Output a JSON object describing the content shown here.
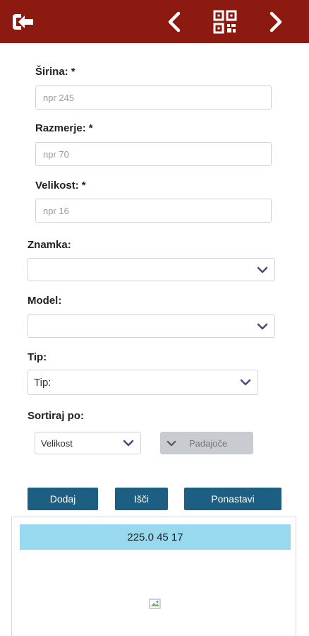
{
  "fields": {
    "sirina": {
      "label": "Širina:",
      "required": "*",
      "placeholder": "npr 245"
    },
    "razmerje": {
      "label": "Razmerje:",
      "required": "*",
      "placeholder": "npr 70"
    },
    "velikost": {
      "label": "Velikost:",
      "required": "*",
      "placeholder": "npr 16"
    },
    "znamka": {
      "label": "Znamka:",
      "value": ""
    },
    "model": {
      "label": "Model:",
      "value": ""
    },
    "tip": {
      "label": "Tip:",
      "value": "Tip:"
    },
    "sort": {
      "label": "Sortiraj po:",
      "value": "Velikost",
      "order": "Padajoče"
    }
  },
  "buttons": {
    "dodaj": "Dodaj",
    "isci": "Išči",
    "ponastavi": "Ponastavi"
  },
  "result": {
    "header": "225.0 45 17"
  },
  "colors": {
    "topbar": "#8c1a10",
    "button": "#1d5f82",
    "result_header": "#98d9ef",
    "chevron": "#4a4a7a"
  }
}
